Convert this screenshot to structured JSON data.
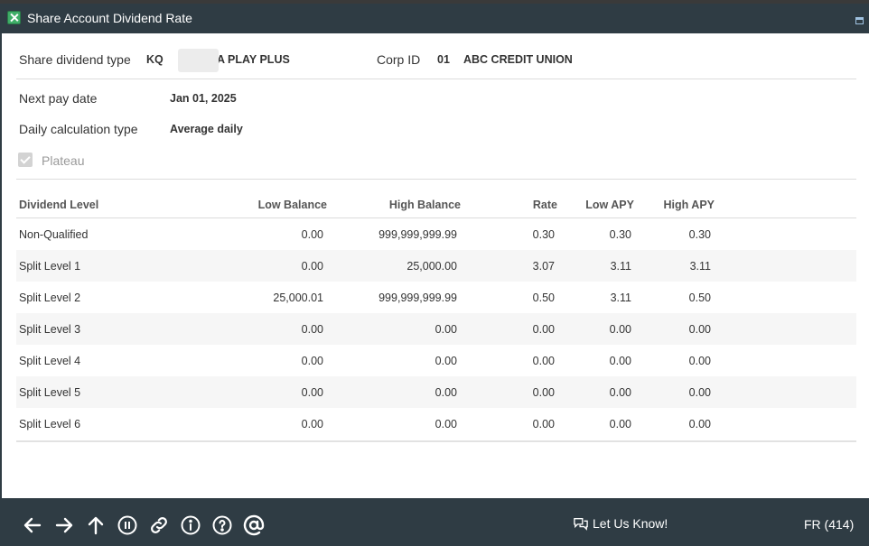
{
  "window": {
    "title": "Share Account Dividend Rate"
  },
  "form": {
    "share_dividend_type_label": "Share dividend type",
    "share_dividend_type_code": "KQ",
    "share_dividend_type_name": "A PLAY PLUS",
    "corp_id_label": "Corp ID",
    "corp_id_value": "01",
    "corp_name": "ABC CREDIT UNION",
    "next_pay_date_label": "Next pay date",
    "next_pay_date_value": "Jan 01, 2025",
    "daily_calc_label": "Daily calculation type",
    "daily_calc_value": "Average daily",
    "plateau_label": "Plateau",
    "plateau_checked": true
  },
  "table": {
    "headers": [
      "Dividend Level",
      "Low Balance",
      "High Balance",
      "Rate",
      "Low APY",
      "High APY"
    ],
    "rows": [
      [
        "Non-Qualified",
        "0.00",
        "999,999,999.99",
        "0.30",
        "0.30",
        "0.30"
      ],
      [
        "Split Level 1",
        "0.00",
        "25,000.00",
        "3.07",
        "3.11",
        "3.11"
      ],
      [
        "Split Level 2",
        "25,000.01",
        "999,999,999.99",
        "0.50",
        "3.11",
        "0.50"
      ],
      [
        "Split Level 3",
        "0.00",
        "0.00",
        "0.00",
        "0.00",
        "0.00"
      ],
      [
        "Split Level 4",
        "0.00",
        "0.00",
        "0.00",
        "0.00",
        "0.00"
      ],
      [
        "Split Level 5",
        "0.00",
        "0.00",
        "0.00",
        "0.00",
        "0.00"
      ],
      [
        "Split Level 6",
        "0.00",
        "0.00",
        "0.00",
        "0.00",
        "0.00"
      ]
    ]
  },
  "footer": {
    "icons": [
      "arrow-left-icon",
      "arrow-right-icon",
      "arrow-up-icon",
      "pause-icon",
      "link-icon",
      "info-icon",
      "help-icon",
      "at-icon"
    ],
    "feedback_label": "Let Us Know!",
    "screen_code": "FR (414)"
  },
  "colors": {
    "chrome": "#2f3c44",
    "panel": "#ffffff",
    "row_alt": "#f6f6f6"
  }
}
